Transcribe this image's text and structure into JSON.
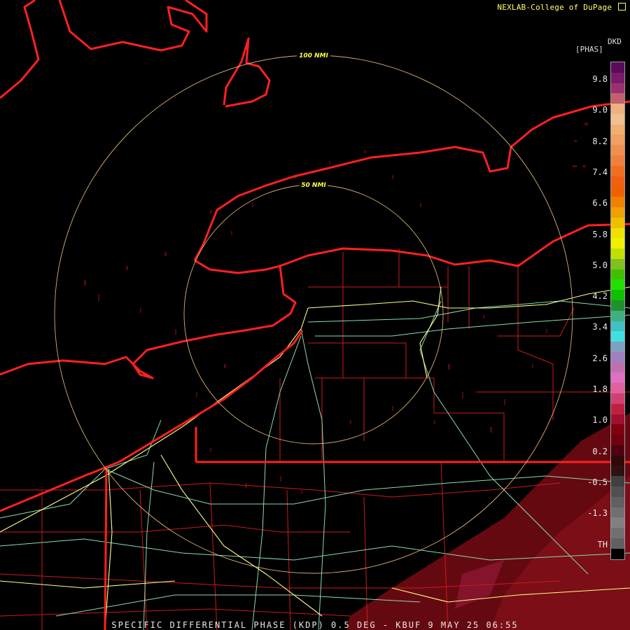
{
  "credit": "NEXLAB-College of DuPage",
  "caption": "SPECIFIC DIFFERENTIAL PHASE (KDP) 0.5 DEG - KBUF 9 MAY 25 06:55",
  "legend": {
    "product": "DKD",
    "units": "[PHAS]",
    "ticks": [
      "9.8",
      "9.0",
      "8.2",
      "7.4",
      "6.6",
      "5.8",
      "5.0",
      "4.2",
      "3.4",
      "2.6",
      "1.8",
      "1.0",
      "0.2",
      "-0.5",
      "-1.3",
      "TH"
    ]
  },
  "range_rings": [
    {
      "label": "100 NMI",
      "nmi": 100
    },
    {
      "label": "50 NMI",
      "nmi": 50
    }
  ],
  "colors": {
    "rings": "#ffcc88",
    "boundaries": "#ff2020",
    "counties": "#cc1a1a",
    "highways": "#ffff88",
    "roads": "#88ddaa",
    "echo": "#7a0a10"
  }
}
